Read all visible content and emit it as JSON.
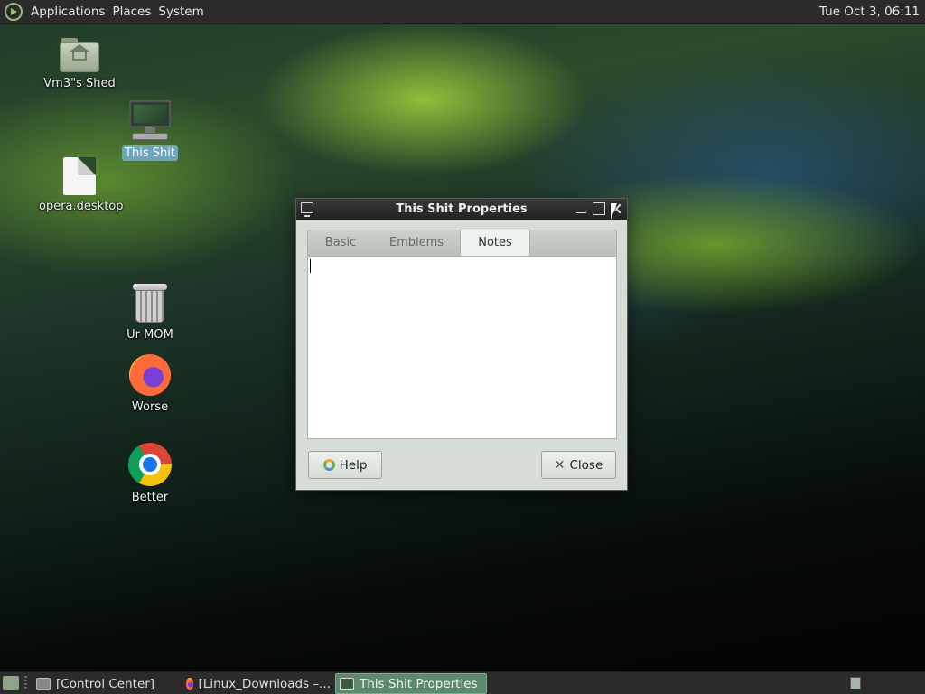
{
  "top_panel": {
    "menus": [
      "Applications",
      "Places",
      "System"
    ],
    "clock": "Tue Oct  3, 06:11"
  },
  "desktop_icons": [
    {
      "label": "Vm3\"s Shed",
      "icon": "home-folder-icon"
    },
    {
      "label": "This Shit",
      "icon": "computer-icon",
      "selected": true
    },
    {
      "label": "opera.desktop",
      "icon": "document-icon"
    },
    {
      "label": "Ur MOM",
      "icon": "trash-icon"
    },
    {
      "label": "Worse",
      "icon": "firefox-icon"
    },
    {
      "label": "Better",
      "icon": "chrome-icon"
    }
  ],
  "dialog": {
    "title": "This Shit Properties",
    "tabs": [
      "Basic",
      "Emblems",
      "Notes"
    ],
    "active_tab": "Notes",
    "notes_text": "",
    "help_label": "Help",
    "close_label": "Close"
  },
  "taskbar": {
    "tasks": [
      "[Control Center]",
      "[Linux_Downloads –...",
      "This Shit Properties"
    ],
    "active_task": "This Shit Properties"
  }
}
